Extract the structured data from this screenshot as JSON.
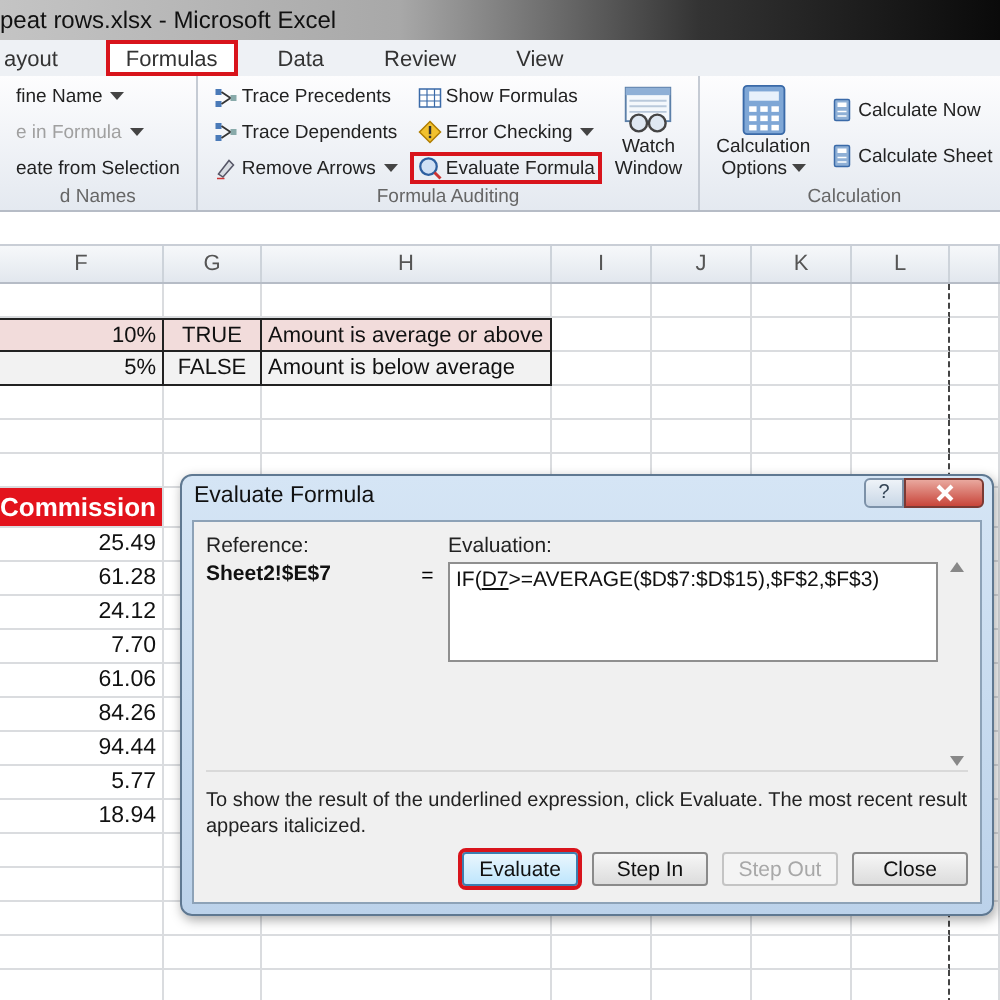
{
  "window": {
    "title": "peat rows.xlsx - Microsoft Excel"
  },
  "tabs": [
    {
      "label": "ayout",
      "selected": false,
      "highlighted": false
    },
    {
      "label": "Formulas",
      "selected": true,
      "highlighted": true
    },
    {
      "label": "Data",
      "selected": false,
      "highlighted": false
    },
    {
      "label": "Review",
      "selected": false,
      "highlighted": false
    },
    {
      "label": "View",
      "selected": false,
      "highlighted": false
    }
  ],
  "ribbon": {
    "groups": [
      {
        "label": "d Names",
        "items": [
          {
            "kind": "small",
            "label": "fine Name",
            "dropdown": true,
            "disabled": false,
            "highlighted": false
          },
          {
            "kind": "small",
            "label": "e in Formula",
            "dropdown": true,
            "disabled": true,
            "highlighted": false
          },
          {
            "kind": "small",
            "label": "eate from Selection",
            "dropdown": false,
            "disabled": false,
            "highlighted": false
          }
        ]
      },
      {
        "label": "Formula Auditing",
        "items": [
          {
            "kind": "small",
            "label": "Trace Precedents",
            "dropdown": false,
            "disabled": false,
            "highlighted": false
          },
          {
            "kind": "small",
            "label": "Trace Dependents",
            "dropdown": false,
            "disabled": false,
            "highlighted": false
          },
          {
            "kind": "small",
            "label": "Remove Arrows",
            "dropdown": true,
            "disabled": false,
            "highlighted": false
          },
          {
            "kind": "small",
            "label": "Show Formulas",
            "dropdown": false,
            "disabled": false,
            "highlighted": false
          },
          {
            "kind": "small",
            "label": "Error Checking",
            "dropdown": true,
            "disabled": false,
            "highlighted": false
          },
          {
            "kind": "small",
            "label": "Evaluate Formula",
            "dropdown": false,
            "disabled": false,
            "highlighted": true
          },
          {
            "kind": "large",
            "label": "Watch Window",
            "dropdown": false,
            "disabled": false,
            "highlighted": false
          }
        ]
      },
      {
        "label": "Calculation",
        "items": [
          {
            "kind": "large",
            "label": "Calculation Options",
            "dropdown": true,
            "disabled": false,
            "highlighted": false
          },
          {
            "kind": "small",
            "label": "Calculate Now",
            "dropdown": false,
            "disabled": false,
            "highlighted": false
          },
          {
            "kind": "small",
            "label": "Calculate Sheet",
            "dropdown": false,
            "disabled": false,
            "highlighted": false
          }
        ]
      }
    ]
  },
  "sheet": {
    "columns": [
      "F",
      "G",
      "H",
      "I",
      "J",
      "K",
      "L"
    ],
    "rate_rows": [
      {
        "cells": [
          "10%",
          "TRUE",
          "Amount is average or above"
        ],
        "color": "#f2dcdb"
      },
      {
        "cells": [
          "5%",
          "FALSE",
          "Amount is below average"
        ],
        "color": "#f2f2f2"
      }
    ],
    "commission": {
      "header": "Commission",
      "values": [
        "25.49",
        "61.28",
        "24.12",
        "7.70",
        "61.06",
        "84.26",
        "94.44",
        "5.77",
        "18.94"
      ]
    }
  },
  "dialog": {
    "title": "Evaluate Formula",
    "help": "?",
    "reference_label": "Reference:",
    "reference": "Sheet2!$E$7",
    "equals": "=",
    "evaluation_label": "Evaluation:",
    "expression": [
      {
        "text": "IF(",
        "underlined": false
      },
      {
        "text": "D7",
        "underlined": true
      },
      {
        "text": ">=AVERAGE($D$7:$D$15),$F$2,$F$3)",
        "underlined": false
      }
    ],
    "note": "To show the result of the underlined expression, click Evaluate.  The most recent result appears italicized.",
    "buttons": [
      {
        "label": "Evaluate",
        "disabled": false,
        "highlighted": true
      },
      {
        "label": "Step In",
        "disabled": false,
        "highlighted": false
      },
      {
        "label": "Step Out",
        "disabled": true,
        "highlighted": false
      },
      {
        "label": "Close",
        "disabled": false,
        "highlighted": false
      }
    ]
  }
}
